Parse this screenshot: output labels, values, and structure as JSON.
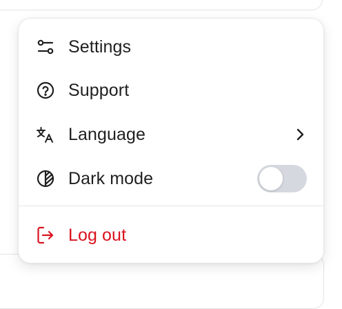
{
  "menu": {
    "items": [
      {
        "label": "Settings",
        "icon": "sliders-icon"
      },
      {
        "label": "Support",
        "icon": "help-circle-icon"
      },
      {
        "label": "Language",
        "icon": "translate-icon",
        "has_submenu": true
      },
      {
        "label": "Dark mode",
        "icon": "contrast-icon",
        "toggle": false
      }
    ],
    "logout": {
      "label": "Log out",
      "icon": "logout-icon"
    }
  },
  "colors": {
    "danger": "#d9121f",
    "text": "#1f1f1f",
    "toggle_off": "#d5d9df"
  }
}
